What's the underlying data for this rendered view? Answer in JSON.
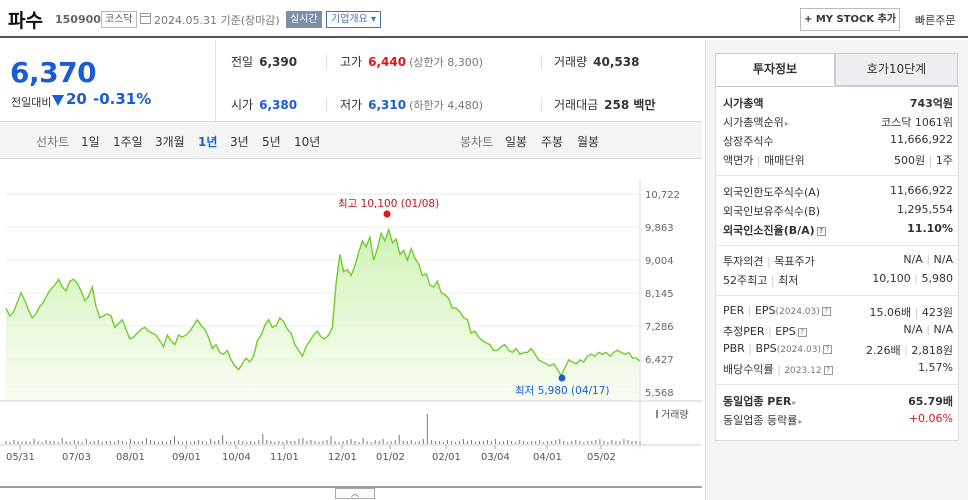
{
  "header": {
    "name": "파수",
    "code": "150900",
    "market_badge": "코스닥",
    "date": "2024.05.31 기준(장마감)",
    "live_badge": "실시간",
    "company_btn": "기업개요 ▾",
    "mystock_btn": "+ MY STOCK 추가",
    "quick_order": "빠른주문"
  },
  "price": {
    "current": "6,370",
    "change_label": "전일대비",
    "change": "20",
    "change_pct": "-0.31%"
  },
  "summary": {
    "prev_label": "전일",
    "prev": "6,390",
    "high_label": "고가",
    "high": "6,440",
    "upper_limit": "(상한가 8,300)",
    "volume_label": "거래량",
    "volume": "40,538",
    "open_label": "시가",
    "open": "6,380",
    "low_label": "저가",
    "low": "6,310",
    "lower_limit": "(하한가 4,480)",
    "amount_label": "거래대금",
    "amount": "258 백만"
  },
  "periods": {
    "line_title": "선차트",
    "line_tabs": [
      "1일",
      "1주일",
      "3개월",
      "1년",
      "3년",
      "5년",
      "10년"
    ],
    "active": "1년",
    "candle_title": "봉차트",
    "candle_tabs": [
      "일봉",
      "주봉",
      "월봉"
    ]
  },
  "chart_data": {
    "type": "line",
    "y_ticks": [
      "10,722",
      "9,863",
      "9,004",
      "8,145",
      "7,286",
      "6,427",
      "5,568"
    ],
    "ylim": [
      5568,
      10722
    ],
    "x_ticks": [
      "05/31",
      "07/03",
      "08/01",
      "09/01",
      "10/04",
      "11/01",
      "12/01",
      "01/02",
      "02/01",
      "03/04",
      "04/01",
      "05/02"
    ],
    "values": [
      7750,
      7550,
      7650,
      7900,
      8150,
      7950,
      7700,
      7500,
      7600,
      7800,
      7900,
      8100,
      8250,
      8350,
      8500,
      8300,
      8200,
      8450,
      8500,
      8400,
      8200,
      7950,
      8050,
      8300,
      7800,
      7500,
      7550,
      7600,
      7550,
      7250,
      7350,
      7450,
      7200,
      6950,
      7000,
      7100,
      7200,
      7250,
      7150,
      7100,
      7050,
      6900,
      6750,
      7050,
      6900,
      6800,
      7050,
      7000,
      7050,
      7150,
      7300,
      7450,
      7300,
      7200,
      7000,
      6700,
      6800,
      6600,
      6550,
      6650,
      6400,
      6250,
      6150,
      6300,
      6450,
      6350,
      6500,
      6900,
      7050,
      7300,
      7450,
      7250,
      7300,
      7500,
      7400,
      7200,
      7100,
      6800,
      6650,
      6500,
      6750,
      6900,
      7050,
      7150,
      7000,
      6950,
      7050,
      7250,
      8400,
      9150,
      8700,
      8750,
      8600,
      8850,
      9200,
      9500,
      9350,
      9600,
      9000,
      9300,
      9700,
      9500,
      9800,
      9450,
      9550,
      9150,
      9250,
      9000,
      9300,
      9050,
      8900,
      8600,
      8650,
      8350,
      8300,
      8450,
      8150,
      8100,
      8000,
      7750,
      7750,
      7650,
      7500,
      7450,
      7100,
      7150,
      7000,
      6900,
      6850,
      6800,
      6650,
      6650,
      6750,
      6800,
      6650,
      6600,
      6700,
      6550,
      6600,
      6600,
      6700,
      6550,
      6400,
      6350,
      6300,
      6250,
      6300,
      6150,
      6000,
      6200,
      6400,
      6350,
      6300,
      6400,
      6350,
      6500,
      6550,
      6500,
      6600,
      6550,
      6600,
      6500,
      6600,
      6650,
      6600,
      6550,
      6600,
      6450,
      6450,
      6370
    ],
    "high_label": "최고 10,100 (01/08)",
    "low_label": "최저 5,980 (04/17)",
    "volume_label": "거래량"
  },
  "invest": {
    "tab_active": "투자정보",
    "tab_other": "호가10단계",
    "rows": {
      "mcap_k": "시가총액",
      "mcap_v": "743억원",
      "rank_k": "시가총액순위",
      "rank_v": "코스닥 1061위",
      "shares_k": "상장주식수",
      "shares_v": "11,666,922",
      "par_k1": "액면가",
      "par_k2": "매매단위",
      "par_v1": "500원",
      "par_v2": "1주",
      "flimit_k": "외국인한도주식수(A)",
      "flimit_v": "11,666,922",
      "fhold_k": "외국인보유주식수(B)",
      "fhold_v": "1,295,554",
      "fratio_k": "외국인소진율(B/A)",
      "fratio_v": "11.10%",
      "opinion_k1": "투자의견",
      "opinion_k2": "목표주가",
      "opinion_v1": "N/A",
      "opinion_v2": "N/A",
      "w52_k1": "52주최고",
      "w52_k2": "최저",
      "w52_v1": "10,100",
      "w52_v2": "5,980",
      "per_k1": "PER",
      "per_k2": "EPS",
      "per_k3": "(2024.03)",
      "per_v1": "15.06배",
      "per_v2": "423원",
      "eper_k1": "추정PER",
      "eper_k2": "EPS",
      "eper_v1": "N/A",
      "eper_v2": "N/A",
      "pbr_k1": "PBR",
      "pbr_k2": "BPS",
      "pbr_k3": "(2024.03)",
      "pbr_v1": "2.26배",
      "pbr_v2": "2,818원",
      "div_k": "배당수익률",
      "div_k2": "2023.12",
      "div_v": "1.57%",
      "sector_per_k": "동일업종 PER",
      "sector_per_v": "65.79배",
      "sector_chg_k": "동일업종 등락률",
      "sector_chg_v": "+0.06%"
    }
  },
  "colors": {
    "down": "#1a5bd6",
    "up": "#e0151d",
    "line": "#6fcd2b"
  }
}
